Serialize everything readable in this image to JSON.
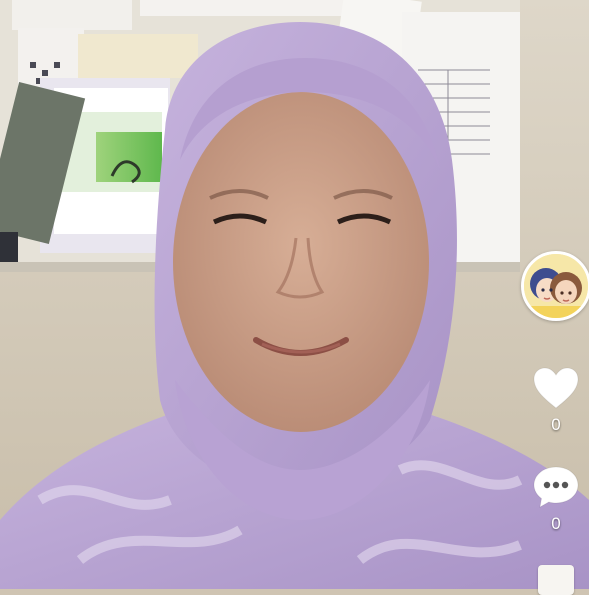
{
  "colors": {
    "wall": "#cfc4b2",
    "hijab": "#bba5d6",
    "skin": "#caa089",
    "icon_white": "#ffffff"
  },
  "actions": {
    "like": {
      "icon": "heart-icon",
      "count": "0"
    },
    "comment": {
      "icon": "chat-bubble-icon",
      "count": "0"
    },
    "share": {
      "icon": "share-icon"
    }
  },
  "profile": {
    "icon": "creator-avatar"
  }
}
